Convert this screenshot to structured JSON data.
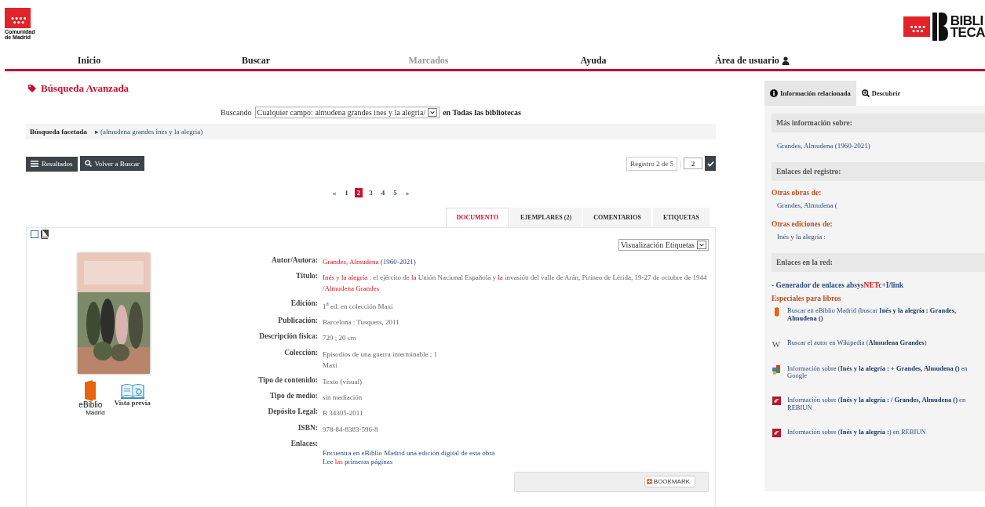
{
  "header": {
    "left_logo": {
      "caption": [
        "Comunidad",
        "de Madrid"
      ]
    },
    "right_logo": {
      "lines": [
        "BIBLI",
        "TECA"
      ]
    }
  },
  "nav": [
    {
      "label": "Inicio",
      "disabled": false
    },
    {
      "label": "Buscar",
      "disabled": false
    },
    {
      "label": "Marcados",
      "disabled": true
    },
    {
      "label": "Ayuda",
      "disabled": false
    },
    {
      "label": "Área de usuario",
      "disabled": false,
      "kind": "user"
    }
  ],
  "page_title": "Búsqueda Avanzada",
  "search_line": {
    "prefix": "Buscando",
    "query": "Cualquier campo: almudena grandes ines y la alegria/",
    "suffix": "en Todas las bibliotecas"
  },
  "faceted": {
    "label": "Búsqueda facetada",
    "marker": "▸",
    "value": "(almudena grandes ines y la alegria)"
  },
  "toolbar": {
    "buttons": [
      {
        "label": "Resultados",
        "kind": "list"
      },
      {
        "label": "Volver a Buscar",
        "kind": "search"
      }
    ],
    "record": "Registro 2 de 5",
    "separator": "|",
    "goto": "2"
  },
  "pagination": [
    {
      "label": "«",
      "selected": false
    },
    {
      "label": "1",
      "selected": false
    },
    {
      "label": "2",
      "selected": true
    },
    {
      "label": "3",
      "selected": false
    },
    {
      "label": "4",
      "selected": false
    },
    {
      "label": "5",
      "selected": false
    },
    {
      "label": "»",
      "selected": false
    }
  ],
  "record_tabs": [
    {
      "label": "DOCUMENTO",
      "selected": true
    },
    {
      "label": "EJEMPLARES (2)",
      "selected": false
    },
    {
      "label": "COMENTARIOS",
      "selected": false
    },
    {
      "label": "ETIQUETAS",
      "selected": false
    }
  ],
  "record": {
    "checked": false,
    "view_select": "Visualización Etiquetas",
    "ebiblio": {
      "text": "eBiblio",
      "sub": "Madrid"
    },
    "preview": "Vista previa",
    "fields": [
      {
        "label": "Autor/Autora:",
        "lines": [
          [
            {
              "text": "Grandes, Almudena",
              "kind": "match"
            },
            {
              "text": " (1960-2021)",
              "kind": "link"
            }
          ]
        ]
      },
      {
        "label": "Título:",
        "lines": [
          [
            {
              "text": "Inés",
              "kind": "match"
            },
            {
              "text": " y ",
              "kind": "plain"
            },
            {
              "text": "la alegría",
              "kind": "match"
            },
            {
              "text": " : el ejército de ",
              "kind": "plain"
            },
            {
              "text": "la",
              "kind": "match"
            },
            {
              "text": " Unión Nacional Española y ",
              "kind": "plain"
            },
            {
              "text": "la",
              "kind": "match"
            },
            {
              "text": " invasión del valle de Arán, Pirineo de Lérida, 19-27 de octubre de 1944 /",
              "kind": "plain"
            },
            {
              "text": "Almudena Grandes",
              "kind": "match"
            }
          ]
        ]
      },
      {
        "label": "Edición:",
        "lines": [
          [
            {
              "text": "1$^{a}$ ed. en colección Maxi",
              "kind": "plain"
            }
          ]
        ]
      },
      {
        "label": "Publicación:",
        "lines": [
          [
            {
              "text": "Barcelona : Tusquets, 2011",
              "kind": "plain"
            }
          ]
        ]
      },
      {
        "label": "Descripción física:",
        "lines": [
          [
            {
              "text": "729 ; 20 cm",
              "kind": "plain"
            }
          ]
        ]
      },
      {
        "label": "Colección:",
        "lines": [
          [
            {
              "text": "Episodios de una guerra interminable ; 1",
              "kind": "plain"
            }
          ],
          [
            {
              "text": "Maxi",
              "kind": "plain"
            }
          ]
        ]
      },
      {
        "label": "Tipo de contenido:",
        "lines": [
          [
            {
              "text": "Texto (visual)",
              "kind": "plain"
            }
          ]
        ]
      },
      {
        "label": "Tipo de medio:",
        "lines": [
          [
            {
              "text": "sin mediación",
              "kind": "plain"
            }
          ]
        ]
      },
      {
        "label": "Depósito Legal:",
        "lines": [
          [
            {
              "text": "B 34305-2011",
              "kind": "plain"
            }
          ]
        ]
      },
      {
        "label": "ISBN:",
        "lines": [
          [
            {
              "text": "978-84-8383-596-8",
              "kind": "plain"
            }
          ]
        ]
      },
      {
        "label": "Enlaces:",
        "kind": "below",
        "lines": [
          [
            {
              "text": "Encuentra en eBiblio Madrid una edición digital de esta obra",
              "kind": "link"
            }
          ],
          [
            {
              "text": "Lee ",
              "kind": "link"
            },
            {
              "text": "las",
              "kind": "match"
            },
            {
              "text": " primeras páginas",
              "kind": "link"
            }
          ]
        ]
      }
    ],
    "bookmark": "BOOKMARK"
  },
  "sidebar": {
    "tabs": [
      {
        "label": "Información relacionada",
        "selected": true,
        "kind": "info"
      },
      {
        "label": "Descubrir",
        "selected": false,
        "kind": "discover"
      }
    ],
    "blocks": [
      {
        "kind": "heading",
        "text": "Más información sobre:"
      },
      {
        "kind": "link",
        "text": "Grandes, Almudena (1960-2021)"
      },
      {
        "kind": "heading",
        "text": "Enlaces del registro:"
      },
      {
        "kind": "subheading",
        "text": "Otras obras de:"
      },
      {
        "kind": "link",
        "text": "Grandes, Almudena ("
      },
      {
        "kind": "subheading",
        "text": "Otras ediciones de:"
      },
      {
        "kind": "link",
        "text": "Inés y la alegría :"
      },
      {
        "kind": "heading",
        "text": "Enlaces en la red:"
      },
      {
        "kind": "generator",
        "segments": [
          {
            "text": "- Generador de enlaces absys",
            "kind": "link"
          },
          {
            "text": "NET",
            "kind": "match"
          },
          {
            "text": "c+I/link",
            "kind": "link"
          }
        ]
      },
      {
        "kind": "subheading",
        "text": "Especiales para libros"
      },
      {
        "kind": "ebiblio",
        "text": "Buscar en eBiblio Madrid (buscar **Inés y la alegría : Grandes, Almudena ()**"
      },
      {
        "kind": "wiki",
        "glyph": "W",
        "text": "Buscar el autor en Wikipedia (**Almudena Grandes**)"
      },
      {
        "kind": "google",
        "text": "Información sobre (**Inés y la alegría : + Grandes, Almudena ()** en Google"
      },
      {
        "kind": "rebiun",
        "text": "Información sobre (**Inés y la alegría : / Grandes, Almudena ()** en REBIUN"
      },
      {
        "kind": "rebiun",
        "text": "Información sobre (**Inés y la alegría :**) en REBIUN"
      }
    ]
  }
}
